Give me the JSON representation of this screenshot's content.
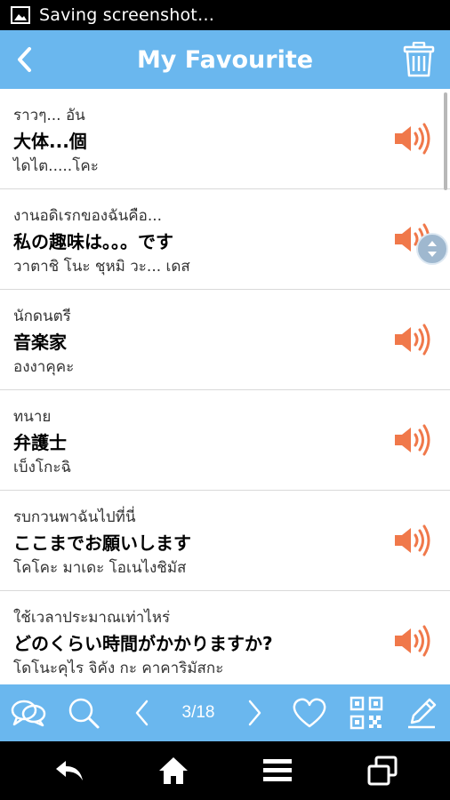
{
  "status_bar": {
    "text": "Saving screenshot…",
    "icon": "image-icon"
  },
  "header": {
    "title": "My Favourite",
    "back_icon": "chevron-left-icon",
    "delete_icon": "trash-icon"
  },
  "entries": [
    {
      "thai": "ราวๆ... อัน",
      "japanese": "大体...個",
      "reading": "ไดไต.....โคะ"
    },
    {
      "thai": "งานอดิเรกของฉันคือ...",
      "japanese": "私の趣味は。。。です",
      "reading": "วาตาชิ โนะ ชุหมิ วะ... เดส"
    },
    {
      "thai": "นักดนตรี",
      "japanese": "音楽家",
      "reading": "องงาคุคะ"
    },
    {
      "thai": "ทนาย",
      "japanese": "弁護士",
      "reading": "เบ็งโกะฉิ"
    },
    {
      "thai": "รบกวนพาฉันไปที่นี่",
      "japanese": "ここまでお願いします",
      "reading": "โคโคะ มาเดะ โอเนไงชิมัส"
    },
    {
      "thai": "ใช้เวลาประมาณเท่าไหร่",
      "japanese": "どのくらい時間がかかりますか?",
      "reading": "โดโนะคุไร จิคัง กะ คาคาริมัสกะ"
    }
  ],
  "toolbar": {
    "page_indicator": "3/18",
    "icons": [
      "speech-bubbles-icon",
      "search-icon",
      "prev-icon",
      "next-icon",
      "heart-icon",
      "qr-code-icon",
      "edit-icon"
    ]
  },
  "nav": {
    "icons": [
      "back-arrow-icon",
      "home-icon",
      "menu-icon",
      "recent-apps-icon"
    ]
  },
  "colors": {
    "accent": "#6ab7ee",
    "speaker": "#f0784a",
    "divider": "#d9d9d9"
  }
}
